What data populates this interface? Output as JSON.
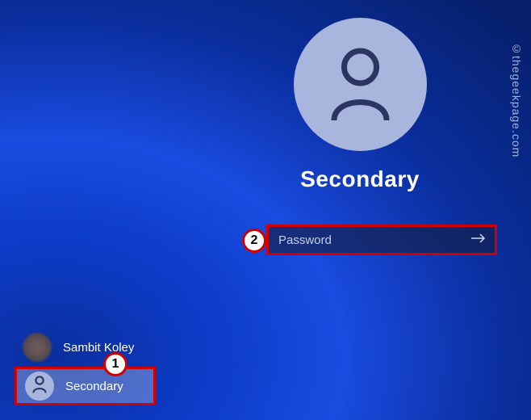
{
  "main_user": {
    "name": "Secondary"
  },
  "password": {
    "placeholder": "Password",
    "value": ""
  },
  "users": [
    {
      "name": "Sambit Koley",
      "selected": false
    },
    {
      "name": "Secondary",
      "selected": true
    }
  ],
  "markers": {
    "one": "1",
    "two": "2"
  },
  "watermark": "©thegeekpage.com"
}
